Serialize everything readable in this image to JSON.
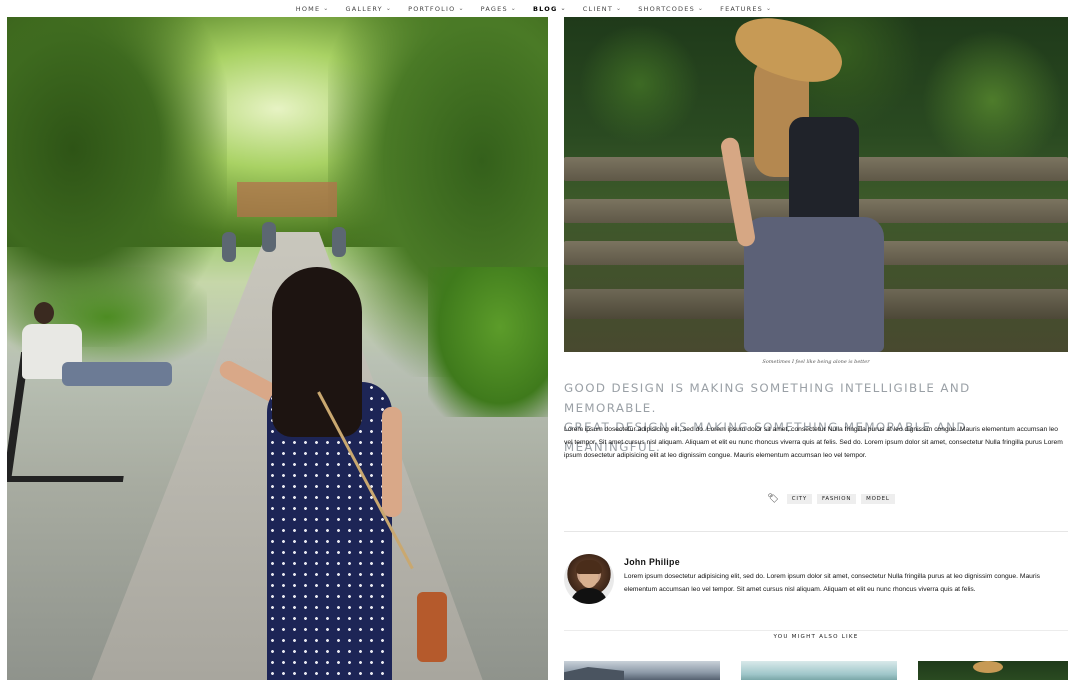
{
  "nav": {
    "items": [
      {
        "label": "HOME",
        "has_dropdown": true
      },
      {
        "label": "GALLERY",
        "has_dropdown": true
      },
      {
        "label": "PORTFOLIO",
        "has_dropdown": true
      },
      {
        "label": "PAGES",
        "has_dropdown": true
      },
      {
        "label": "BLOG",
        "has_dropdown": true,
        "active": true
      },
      {
        "label": "CLIENT",
        "has_dropdown": true
      },
      {
        "label": "SHORTCODES",
        "has_dropdown": true
      },
      {
        "label": "FEATURES",
        "has_dropdown": true
      }
    ]
  },
  "post": {
    "feature_caption": "Sometimes I feel like being alone is better",
    "headline_line1": "GOOD DESIGN IS MAKING SOMETHING INTELLIGIBLE AND MEMORABLE.",
    "headline_line2": "GREAT DESIGN IS MAKING SOMETHING MEMORABLE AND MEANINGFUL.",
    "body": "Lorem ipsum dosectetur adipisicing elit, sed do. Lorem ipsum dolor sit amet, consectetur Nulla fringilla purus at leo dignissim congue. Mauris elementum accumsan leo vel tempor. Sit amet cursus nisl aliquam. Aliquam et elit eu nunc rhoncus viverra quis at felis. Sed do. Lorem ipsum dolor sit amet, consectetur Nulla fringilla purus Lorem ipsum dosectetur adipisicing elit at leo dignissim congue. Mauris elementum accumsan leo vel tempor.",
    "tags": [
      "CITY",
      "FASHION",
      "MODEL"
    ]
  },
  "author": {
    "name": "John Philipe",
    "bio": "Lorem ipsum dosectetur adipisicing elit, sed do. Lorem ipsum dolor sit amet, consectetur Nulla fringilla purus at leo dignissim congue. Mauris elementum accumsan leo vel tempor. Sit amet cursus nisl aliquam. Aliquam et elit eu nunc rhoncus viverra quis at felis."
  },
  "related": {
    "heading": "YOU MIGHT ALSO LIKE"
  }
}
